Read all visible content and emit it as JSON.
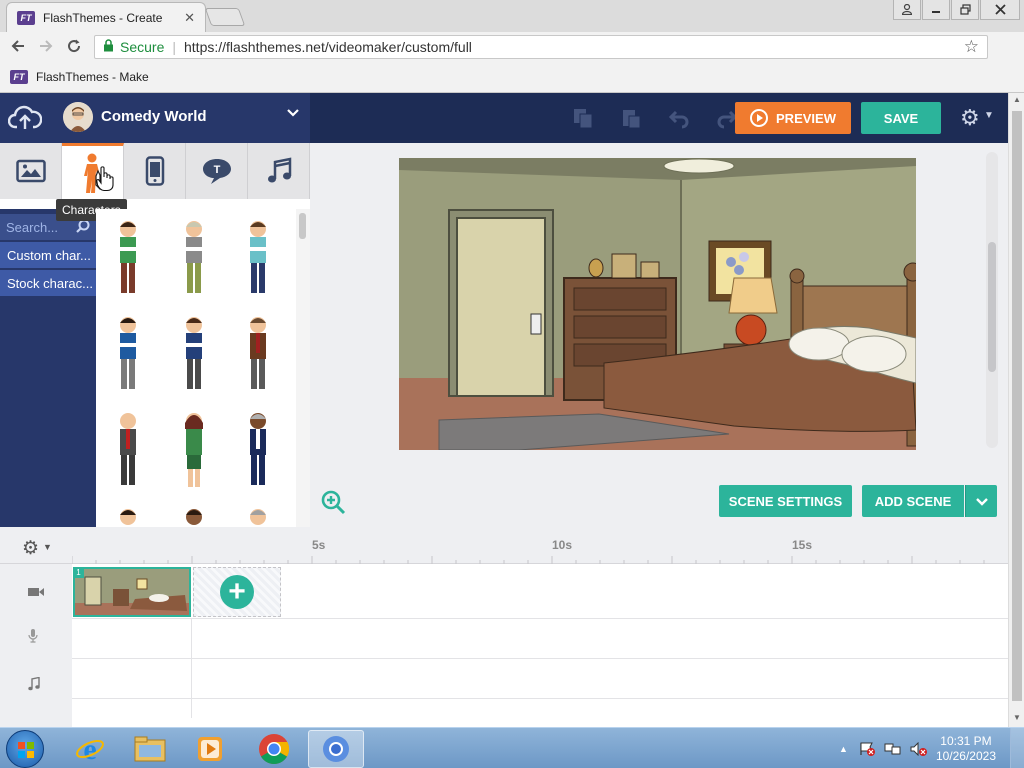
{
  "browser": {
    "tab_title": "FlashThemes - Create",
    "tab_close": "✕",
    "favicon_text": "FT",
    "secure_label": "Secure",
    "url": "https://flashthemes.net/videomaker/custom/full",
    "bookmark_title": "FlashThemes - Make"
  },
  "app": {
    "theme_name": "Comedy World",
    "preview_label": "PREVIEW",
    "save_label": "SAVE",
    "library": {
      "tabs": [
        "backgrounds",
        "characters",
        "props",
        "text",
        "music"
      ],
      "active_tab": "characters",
      "tooltip": "Characters",
      "search_placeholder": "Search...",
      "categories": [
        "Custom char...",
        "Stock charac..."
      ]
    },
    "scene_settings_label": "SCENE SETTINGS",
    "add_scene_label": "ADD SCENE",
    "timeline": {
      "markers": [
        "5s",
        "10s",
        "15s"
      ],
      "scene_number": "1",
      "add_symbol": "+"
    }
  },
  "taskbar": {
    "time": "10:31 PM",
    "date": "10/26/2023"
  },
  "colors": {
    "header_dark": "#1d2c55",
    "header_panel": "#27376a",
    "preview_orange": "#f07b2f",
    "teal": "#2cb49b"
  }
}
